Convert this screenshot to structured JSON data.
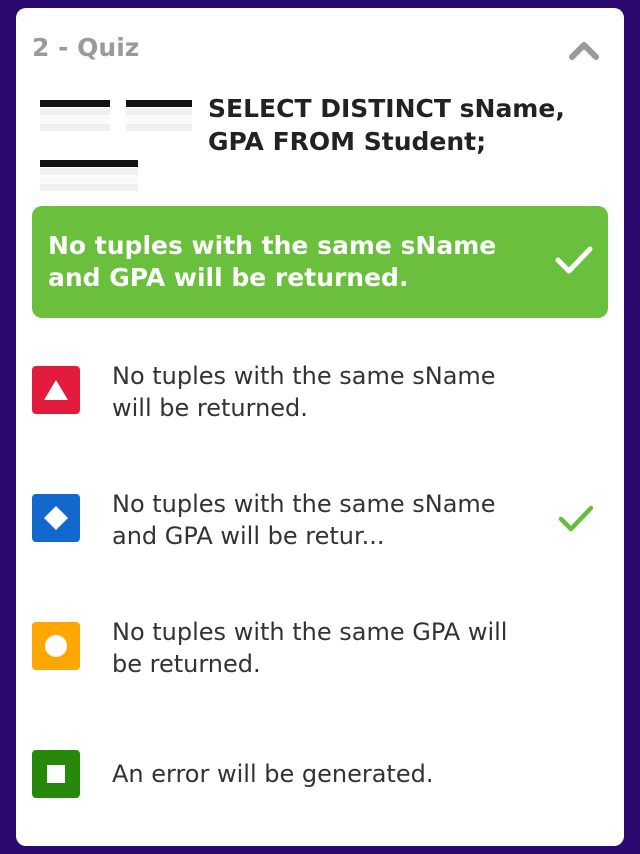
{
  "quiz": {
    "title": "2 - Quiz",
    "question": "SELECT DISTINCT sName, GPA FROM Student;",
    "correct_answer": "No tuples with the same sName and GPA will be returned.",
    "options": [
      {
        "shape": "triangle-icon",
        "color": "#e21b3c",
        "text": "No tuples with the same sName will be returned.",
        "correct": false
      },
      {
        "shape": "diamond-icon",
        "color": "#1368ce",
        "text": "No tuples with the same sName and GPA will be retur...",
        "correct": true
      },
      {
        "shape": "circle-icon",
        "color": "#ffa602",
        "text": "No tuples with the same GPA will be returned.",
        "correct": false
      },
      {
        "shape": "square-icon",
        "color": "#26890c",
        "text": "An error will be generated.",
        "correct": false
      }
    ]
  },
  "colors": {
    "background": "#2a0a6e",
    "correct_green": "#6abf3c",
    "check_green": "#66bf39"
  },
  "icons": {
    "collapse": "chevron-up-icon",
    "correct_check": "checkmark-icon"
  }
}
